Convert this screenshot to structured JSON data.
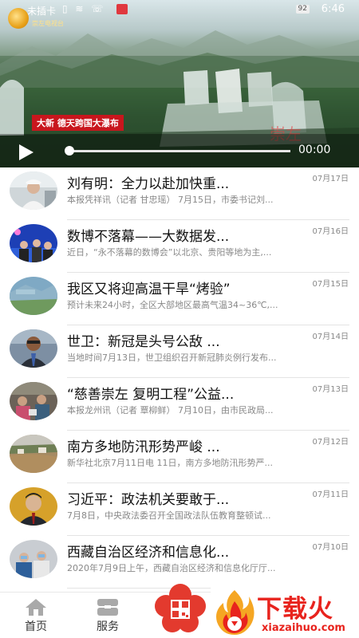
{
  "status_bar": {
    "carrier": "未插卡",
    "battery": "92",
    "time": "6:46"
  },
  "video": {
    "logo_text": "崇左电视台",
    "caption": "大新 德天跨国大瀑布",
    "watermark": "崇左",
    "time": "00:00",
    "progress": 0
  },
  "news": [
    {
      "title": "刘有明：全力以赴加快重...",
      "date": "07月17日",
      "summary": "本报凭祥讯（记者 甘忠瑶） 7月15日，市委书记刘..."
    },
    {
      "title": "数博不落幕——大数据发...",
      "date": "07月16日",
      "summary": "近日，“永不落幕的数博会”以北京、贵阳等地为主,..."
    },
    {
      "title": "我区又将迎高温干旱“烤验”",
      "date": "07月15日",
      "summary": "预计未来24小时，全区大部地区最高气温34~36℃,..."
    },
    {
      "title": "世卫：新冠是头号公敌 ...",
      "date": "07月14日",
      "summary": "当地时间7月13日，世卫组织召开新冠肺炎例行发布..."
    },
    {
      "title": "“慈善崇左 复明工程”公益...",
      "date": "07月13日",
      "summary": "本报龙州讯（记者 覃柳鲜） 7月10日，由市民政局..."
    },
    {
      "title": "南方多地防汛形势严峻 ...",
      "date": "07月12日",
      "summary": "新华社北京7月11日电 11日，南方多地防汛形势严..."
    },
    {
      "title": "习近平：政法机关要敢于...",
      "date": "07月11日",
      "summary": "7月8日，中央政法委召开全国政法队伍教育整顿试..."
    },
    {
      "title": "西藏自治区经济和信息化...",
      "date": "07月10日",
      "summary": "2020年7月9日上午，西藏自治区经济和信息化厅厅..."
    }
  ],
  "nav": {
    "home": "首页",
    "services": "服务"
  },
  "download_badge": {
    "title": "下载火",
    "url": "xiazaihuo.com"
  },
  "colors": {
    "brand_red": "#c8161d",
    "badge_red": "#e8231d"
  }
}
